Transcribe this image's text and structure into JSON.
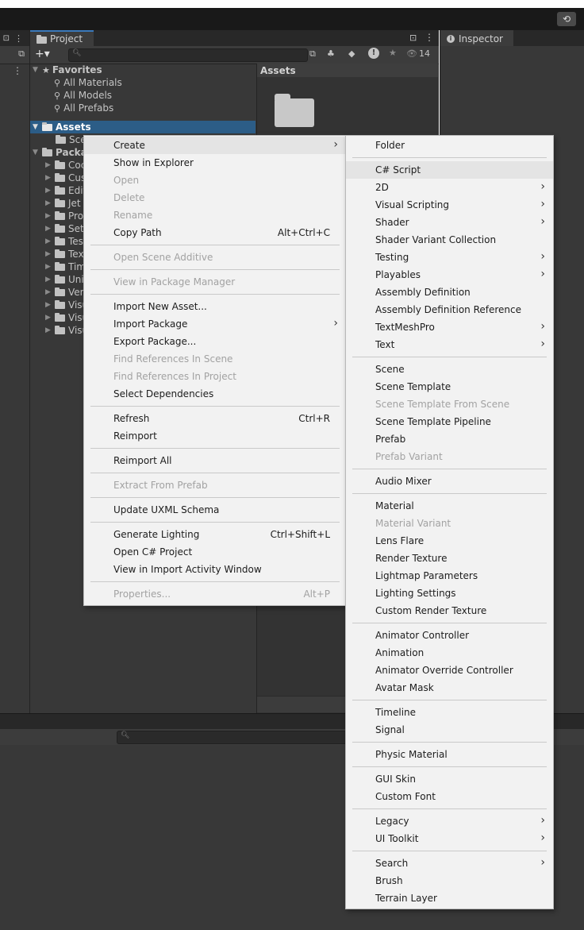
{
  "left_panel": {
    "icons": [
      "lock-icon",
      "more-icon"
    ]
  },
  "project_panel": {
    "tab_label": "Project",
    "hidden_count": "14",
    "search_placeholder": "",
    "favorites": {
      "label": "Favorites",
      "items": [
        "All Materials",
        "All Models",
        "All Prefabs"
      ]
    },
    "assets_tree": {
      "assets_label": "Assets",
      "assets_children": [
        "Sce"
      ],
      "packages_label": "Packa",
      "package_children": [
        "Coc",
        "Cus",
        "Edit",
        "Jet",
        "Pro",
        "Set",
        "Tes",
        "Tex",
        "Tim",
        "Uni",
        "Ver",
        "Visu",
        "Visu",
        "Visu"
      ]
    },
    "grid_header": "Assets"
  },
  "inspector": {
    "tab_label": "Inspector"
  },
  "context_menu": {
    "items": [
      {
        "label": "Create",
        "submenu": true,
        "highlighted": true
      },
      {
        "label": "Show in Explorer"
      },
      {
        "label": "Open",
        "disabled": true
      },
      {
        "label": "Delete",
        "disabled": true
      },
      {
        "label": "Rename",
        "disabled": true
      },
      {
        "label": "Copy Path",
        "shortcut": "Alt+Ctrl+C"
      },
      {
        "separator": true
      },
      {
        "label": "Open Scene Additive",
        "disabled": true
      },
      {
        "separator": true
      },
      {
        "label": "View in Package Manager",
        "disabled": true
      },
      {
        "separator": true
      },
      {
        "label": "Import New Asset..."
      },
      {
        "label": "Import Package",
        "submenu": true
      },
      {
        "label": "Export Package..."
      },
      {
        "label": "Find References In Scene",
        "disabled": true
      },
      {
        "label": "Find References In Project",
        "disabled": true
      },
      {
        "label": "Select Dependencies"
      },
      {
        "separator": true
      },
      {
        "label": "Refresh",
        "shortcut": "Ctrl+R"
      },
      {
        "label": "Reimport"
      },
      {
        "separator": true
      },
      {
        "label": "Reimport All"
      },
      {
        "separator": true
      },
      {
        "label": "Extract From Prefab",
        "disabled": true
      },
      {
        "separator": true
      },
      {
        "label": "Update UXML Schema"
      },
      {
        "separator": true
      },
      {
        "label": "Generate Lighting",
        "shortcut": "Ctrl+Shift+L"
      },
      {
        "label": "Open C# Project"
      },
      {
        "label": "View in Import Activity Window"
      },
      {
        "separator": true
      },
      {
        "label": "Properties...",
        "shortcut": "Alt+P",
        "disabled": true
      }
    ]
  },
  "create_submenu": {
    "items": [
      {
        "label": "Folder"
      },
      {
        "separator": true
      },
      {
        "label": "C# Script",
        "highlighted": true
      },
      {
        "label": "2D",
        "submenu": true
      },
      {
        "label": "Visual Scripting",
        "submenu": true
      },
      {
        "label": "Shader",
        "submenu": true
      },
      {
        "label": "Shader Variant Collection"
      },
      {
        "label": "Testing",
        "submenu": true
      },
      {
        "label": "Playables",
        "submenu": true
      },
      {
        "label": "Assembly Definition"
      },
      {
        "label": "Assembly Definition Reference"
      },
      {
        "label": "TextMeshPro",
        "submenu": true
      },
      {
        "label": "Text",
        "submenu": true
      },
      {
        "separator": true
      },
      {
        "label": "Scene"
      },
      {
        "label": "Scene Template"
      },
      {
        "label": "Scene Template From Scene",
        "disabled": true
      },
      {
        "label": "Scene Template Pipeline"
      },
      {
        "label": "Prefab"
      },
      {
        "label": "Prefab Variant",
        "disabled": true
      },
      {
        "separator": true
      },
      {
        "label": "Audio Mixer"
      },
      {
        "separator": true
      },
      {
        "label": "Material"
      },
      {
        "label": "Material Variant",
        "disabled": true
      },
      {
        "label": "Lens Flare"
      },
      {
        "label": "Render Texture"
      },
      {
        "label": "Lightmap Parameters"
      },
      {
        "label": "Lighting Settings"
      },
      {
        "label": "Custom Render Texture"
      },
      {
        "separator": true
      },
      {
        "label": "Animator Controller"
      },
      {
        "label": "Animation"
      },
      {
        "label": "Animator Override Controller"
      },
      {
        "label": "Avatar Mask"
      },
      {
        "separator": true
      },
      {
        "label": "Timeline"
      },
      {
        "label": "Signal"
      },
      {
        "separator": true
      },
      {
        "label": "Physic Material"
      },
      {
        "separator": true
      },
      {
        "label": "GUI Skin"
      },
      {
        "label": "Custom Font"
      },
      {
        "separator": true
      },
      {
        "label": "Legacy",
        "submenu": true
      },
      {
        "label": "UI Toolkit",
        "submenu": true
      },
      {
        "separator": true
      },
      {
        "label": "Search",
        "submenu": true
      },
      {
        "label": "Brush"
      },
      {
        "label": "Terrain Layer"
      }
    ]
  }
}
